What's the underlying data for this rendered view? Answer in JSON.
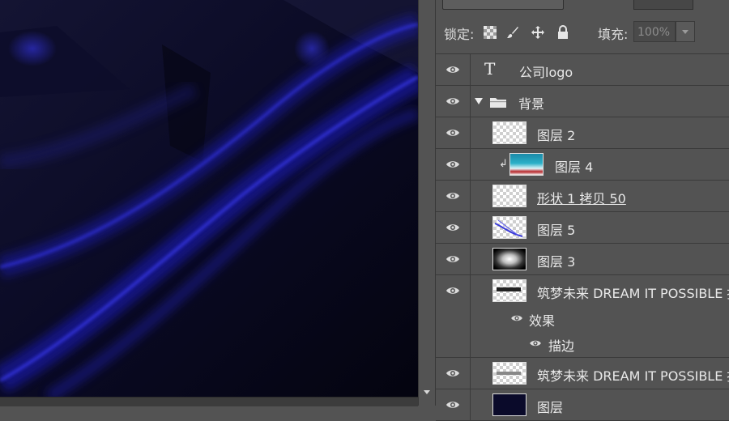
{
  "panel": {
    "lock_label": "锁定:",
    "fill_label": "填充:",
    "fill_value": "100%"
  },
  "layers": [
    {
      "type": "text",
      "name": "公司logo",
      "visible": true
    },
    {
      "type": "group",
      "name": "背景",
      "visible": true,
      "expanded": true
    },
    {
      "type": "layer",
      "name": "图层 2",
      "visible": true,
      "thumb": "transparent"
    },
    {
      "type": "layer",
      "name": "图层 4",
      "visible": true,
      "thumb": "teal-image",
      "clipped": true
    },
    {
      "type": "layer",
      "name": "形状 1 拷贝 50",
      "visible": true,
      "thumb": "transparent",
      "underline": true
    },
    {
      "type": "layer",
      "name": "图层 5",
      "visible": true,
      "thumb": "blue-lines"
    },
    {
      "type": "layer",
      "name": "图层 3",
      "visible": true,
      "thumb": "black-glow"
    },
    {
      "type": "layer",
      "name": "筑梦未来 DREAM IT POSSIBLE 拷",
      "visible": true,
      "thumb": "text-dark",
      "effects_label": "效果",
      "stroke_label": "描边"
    },
    {
      "type": "layer",
      "name": "筑梦未来 DREAM IT POSSIBLE 拷",
      "visible": true,
      "thumb": "text-light"
    },
    {
      "type": "layer",
      "name": "图层",
      "visible": true,
      "thumb": "dark"
    }
  ],
  "colors": {
    "panel_bg": "#535353",
    "canvas_bg": "#06061a",
    "accent_blue": "#2a2ad8"
  }
}
